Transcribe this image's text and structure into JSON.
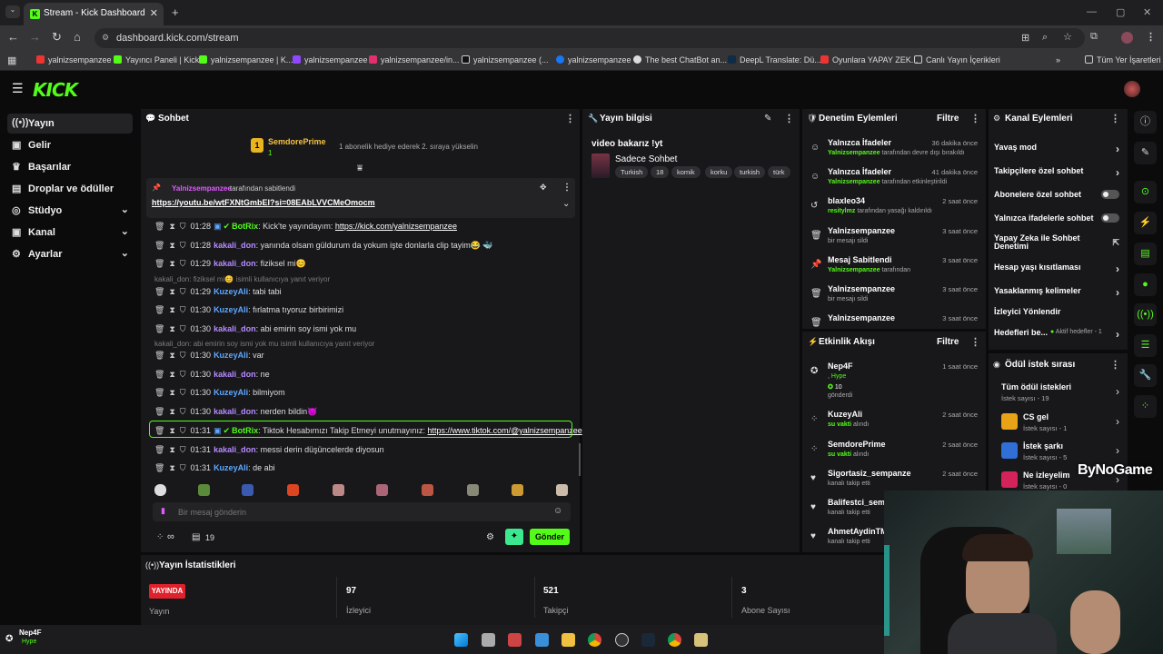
{
  "browser": {
    "tab_title": "Stream - Kick Dashboard",
    "url": "dashboard.kick.com/stream",
    "bookmarks": [
      "yalnizsempanzee",
      "Yayıncı Paneli | Kick",
      "yalnizsempanzee | K...",
      "yalnizsempanzee",
      "yalnizsempanzee/in...",
      "yalnizsempanzee (...",
      "yalnizsempanzee",
      "The best ChatBot an...",
      "DeepL Translate: Dü...",
      "Oyunlara YAPAY ZEK...",
      "Canlı Yayın İçerikleri"
    ],
    "bookmarks_all": "Tüm Yer İşaretleri"
  },
  "colors": {
    "accent": "#53fc18",
    "bg": "#0b0b0c",
    "panel": "#18181b",
    "live": "#e0212c"
  },
  "sidebar": {
    "items": [
      "Yayın",
      "Gelir",
      "Başarılar",
      "Droplar ve ödüller",
      "Stüdyo",
      "Kanal",
      "Ayarlar"
    ]
  },
  "chat": {
    "title": "Sohbet",
    "top_gifter": {
      "name": "SemdorePrime",
      "rank": "1",
      "count": "1",
      "hint": "1 abonelik hediye ederek 2. sıraya yükselin"
    },
    "pinned": {
      "by": "Yalnizsempanzee",
      "label": "tarafından sabitlendi",
      "link": "https://youtu.be/wtFXNtGmbEI?si=08EAbLVVCMeOmocm"
    },
    "messages": [
      {
        "time": "01:28",
        "user": "BotRix",
        "text": "Kick'te yayındayım: ",
        "link": "https://kick.com/yalnizsempanzee"
      },
      {
        "time": "01:28",
        "user": "kakali_don",
        "text": "yanında olsam güldurum da yokum işte donlarla clip tayim😂 🐳"
      },
      {
        "time": "01:29",
        "user": "kakali_don",
        "text": "fiziksel mi😊"
      },
      {
        "reply": "kakali_don: fiziksel mi😊 isimli kullanıcıya yanıt veriyor"
      },
      {
        "time": "01:29",
        "user": "KuzeyAli",
        "text": "tabi tabi"
      },
      {
        "time": "01:30",
        "user": "KuzeyAli",
        "text": "fırlatma tıyoruz birbirimizi"
      },
      {
        "time": "01:30",
        "user": "kakali_don",
        "text": "abi emirin soy ismi yok mu"
      },
      {
        "reply": "kakali_don: abi emirin soy ismi yok mu isimli kullanıcıya yanıt veriyor"
      },
      {
        "time": "01:30",
        "user": "KuzeyAli",
        "text": "var"
      },
      {
        "time": "01:30",
        "user": "kakali_don",
        "text": "ne"
      },
      {
        "time": "01:30",
        "user": "KuzeyAli",
        "text": "bilmiyom"
      },
      {
        "time": "01:30",
        "user": "kakali_don",
        "text": "nerden bildin😈"
      },
      {
        "time": "01:31",
        "user": "BotRix",
        "text": "Tiktok Hesabımızı Takip Etmeyi unutmayınız: ",
        "link": "https://www.tiktok.com/@yalnizsempanzee"
      },
      {
        "time": "01:31",
        "user": "kakali_don",
        "text": "messi derin düşüncelerde diyosun"
      },
      {
        "time": "01:31",
        "user": "KuzeyAli",
        "text": "de abi"
      }
    ],
    "input_placeholder": "Bir mesaj gönderin",
    "infinity": "∞",
    "count": "19",
    "send": "Gönder"
  },
  "stream_info": {
    "title": "Yayın bilgisi",
    "stream_title": "video bakarız !yt",
    "category": "Sadece Sohbet",
    "tags": [
      "Turkish",
      "18",
      "komik",
      "korku",
      "turkish",
      "türk"
    ]
  },
  "mod_actions": {
    "title": "Denetim Eylemleri",
    "filter": "Filtre",
    "items": [
      {
        "t1": "Yalnızca İfadeler",
        "by": "Yalnizsempanzee",
        "t2": "tarafından devre dışı bırakıldı",
        "time": "36 dakika önce",
        "icon": "☺"
      },
      {
        "t1": "Yalnızca İfadeler",
        "by": "Yalnizsempanzee",
        "t2": "tarafından etkinleştirildi",
        "time": "41 dakika önce",
        "icon": "☺"
      },
      {
        "t1": "blaxleo34",
        "by": "resitylmz",
        "t2": "tarafından yasağı kaldırıldı",
        "time": "2 saat önce",
        "icon": "↺"
      },
      {
        "t1": "Yalnizsempanzee",
        "by": "",
        "t2": "bir mesajı sildi",
        "time": "3 saat önce",
        "icon": "🗑"
      },
      {
        "t1": "Mesaj Sabitlendi",
        "by": "Yalnizsempanzee",
        "t2": "tarafından",
        "time": "3 saat önce",
        "icon": "📌"
      },
      {
        "t1": "Yalnizsempanzee",
        "by": "",
        "t2": "bir mesajı sildi",
        "time": "3 saat önce",
        "icon": "🗑"
      },
      {
        "t1": "Yalnizsempanzee",
        "by": "",
        "t2": "",
        "time": "3 saat önce",
        "icon": "🗑"
      }
    ]
  },
  "activity": {
    "title": "Etkinlik Akışı",
    "filter": "Filtre",
    "items": [
      {
        "t1": "Nep4F",
        "t2": "Hype",
        "t3": "10",
        "t4": "gönderdi",
        "time": "1 saat önce"
      },
      {
        "t1": "KuzeyAli",
        "by": "su vakti",
        "t2": "alındı",
        "time": "2 saat önce"
      },
      {
        "t1": "SemdorePrime",
        "by": "su vakti",
        "t2": "alındı",
        "time": "2 saat önce"
      },
      {
        "t1": "Sigortasiz_sempanze",
        "t2": "kanalı takip etti",
        "time": "2 saat önce"
      },
      {
        "t1": "Balifestci_semp",
        "t2": "kanalı takip etti",
        "time": ""
      },
      {
        "t1": "AhmetAydinTM",
        "t2": "kanalı takip etti",
        "time": ""
      }
    ]
  },
  "channel_actions": {
    "title": "Kanal Eylemleri",
    "items": [
      "Yavaş mod",
      "Takipçilere özel sohbet",
      "Abonelere özel sohbet",
      "Yalnızca ifadelerle sohbet",
      "Yapay Zeka ile Sohbet Denetimi",
      "Hesap yaşı kısıtlaması",
      "Yasaklanmış kelimeler",
      "İzleyici Yönlendir",
      "Hedefleri be..."
    ],
    "goal_active": "Aktif hedefler - 1"
  },
  "rewards": {
    "title": "Ödül istek sırası",
    "all": "Tüm ödül istekleri",
    "all_count": "İstek sayısı - 19",
    "items": [
      {
        "name": "CS gel",
        "count": "İstek sayısı - 1"
      },
      {
        "name": "İstek şarkı",
        "count": "İstek sayısı - 5"
      },
      {
        "name": "Ne izleyelim",
        "count": "İstek sayısı - 0"
      }
    ]
  },
  "stats": {
    "title": "Yayın İstatistikleri",
    "live": "YAYINDA",
    "live_label": "Yayın",
    "viewers": "97",
    "viewers_label": "İzleyici",
    "followers": "521",
    "followers_label": "Takipçi",
    "subs": "3",
    "subs_label": "Abone Sayısı"
  },
  "watermark": "ByNoGame",
  "footer_user": {
    "name": "Nep4F",
    "sub": "Hype"
  }
}
